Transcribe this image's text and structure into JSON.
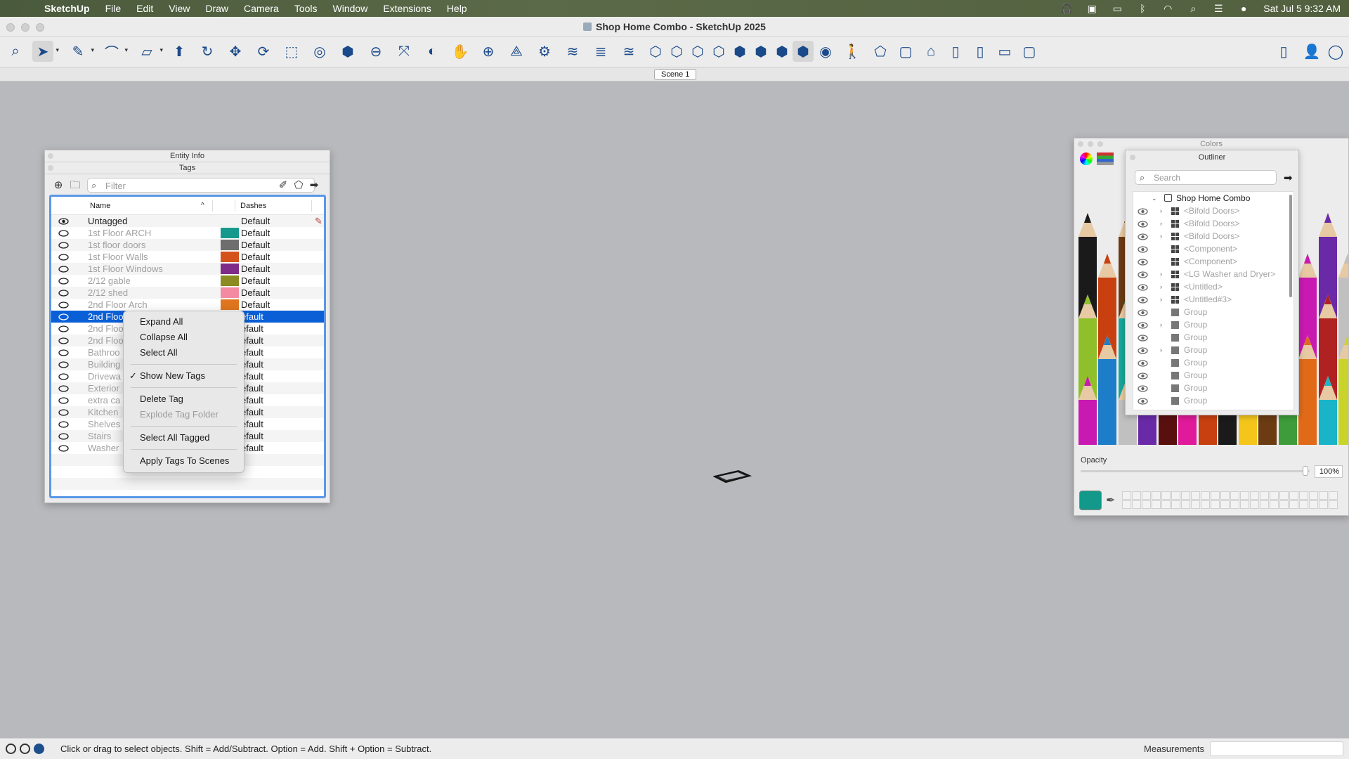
{
  "menubar": {
    "app_name": "SketchUp",
    "items": [
      "File",
      "Edit",
      "View",
      "Draw",
      "Camera",
      "Tools",
      "Window",
      "Extensions",
      "Help"
    ],
    "clock": "Sat Jul 5  9:32 AM"
  },
  "window": {
    "title": "Shop Home Combo - SketchUp 2025"
  },
  "scenes": {
    "tabs": [
      "Scene 1"
    ]
  },
  "entity_info": {
    "title": "Entity Info"
  },
  "tags_panel": {
    "title": "Tags",
    "filter_placeholder": "Filter",
    "col_name": "Name",
    "col_dashes": "Dashes",
    "rows": [
      {
        "name": "Untagged",
        "color": "",
        "dashes": "Default",
        "active": true
      },
      {
        "name": "1st Floor ARCH",
        "color": "#16998c",
        "dashes": "Default"
      },
      {
        "name": "1st floor doors",
        "color": "#6e6e6e",
        "dashes": "Default"
      },
      {
        "name": "1st Floor Walls",
        "color": "#d4531d",
        "dashes": "Default"
      },
      {
        "name": "1st Floor Windows",
        "color": "#7e2b89",
        "dashes": "Default"
      },
      {
        "name": "2/12 gable",
        "color": "#8b8b21",
        "dashes": "Default"
      },
      {
        "name": "2/12 shed",
        "color": "#f38aa2",
        "dashes": "Default"
      },
      {
        "name": "2nd Floor Arch",
        "color": "#e0771f",
        "dashes": "Default"
      },
      {
        "name": "2nd Floo",
        "color": "",
        "dashes": "efault",
        "selected": true
      },
      {
        "name": "2nd Floo",
        "color": "",
        "dashes": "efault"
      },
      {
        "name": "2nd Floo",
        "color": "",
        "dashes": "efault"
      },
      {
        "name": "Bathroo",
        "color": "",
        "dashes": "efault"
      },
      {
        "name": "Building",
        "color": "",
        "dashes": "efault"
      },
      {
        "name": "Drivewa",
        "color": "",
        "dashes": "efault"
      },
      {
        "name": "Exterior",
        "color": "",
        "dashes": "efault"
      },
      {
        "name": "extra ca",
        "color": "",
        "dashes": "efault"
      },
      {
        "name": "Kitchen",
        "color": "",
        "dashes": "efault"
      },
      {
        "name": "Shelves",
        "color": "",
        "dashes": "efault"
      },
      {
        "name": "Stairs",
        "color": "",
        "dashes": "efault"
      },
      {
        "name": "Washer",
        "color": "",
        "dashes": "efault"
      }
    ]
  },
  "context_menu": {
    "items": [
      {
        "label": "Expand All"
      },
      {
        "label": "Collapse All"
      },
      {
        "label": "Select All"
      },
      {
        "sep": true
      },
      {
        "label": "Show New Tags",
        "checked": true
      },
      {
        "sep": true
      },
      {
        "label": "Delete Tag"
      },
      {
        "label": "Explode Tag Folder",
        "disabled": true
      },
      {
        "sep": true
      },
      {
        "label": "Select All Tagged"
      },
      {
        "sep": true
      },
      {
        "label": "Apply Tags To Scenes"
      }
    ]
  },
  "colors_panel": {
    "title": "Colors",
    "opacity_label": "Opacity",
    "opacity_value": "100%",
    "opacity_fraction": 1.0,
    "current_color": "#12998a"
  },
  "outliner": {
    "title": "Outliner",
    "search_placeholder": "Search",
    "root": "Shop Home Combo",
    "items": [
      {
        "label": "<Bifold Doors>",
        "type": "component",
        "expandable": true
      },
      {
        "label": "<Bifold Doors>",
        "type": "component",
        "expandable": true
      },
      {
        "label": "<Bifold Doors>",
        "type": "component",
        "expandable": true
      },
      {
        "label": "<Component>",
        "type": "component",
        "expandable": false
      },
      {
        "label": "<Component>",
        "type": "component",
        "expandable": false
      },
      {
        "label": "<LG Washer and Dryer>",
        "type": "component",
        "expandable": true
      },
      {
        "label": "<Untitled>",
        "type": "component",
        "expandable": true
      },
      {
        "label": "<Untitled#3>",
        "type": "component",
        "expandable": true
      },
      {
        "label": "Group",
        "type": "group",
        "expandable": false
      },
      {
        "label": "Group",
        "type": "group",
        "expandable": true
      },
      {
        "label": "Group",
        "type": "group",
        "expandable": false
      },
      {
        "label": "Group",
        "type": "group",
        "expandable": true
      },
      {
        "label": "Group",
        "type": "group",
        "expandable": false
      },
      {
        "label": "Group",
        "type": "group",
        "expandable": false
      },
      {
        "label": "Group",
        "type": "group",
        "expandable": false
      },
      {
        "label": "Group",
        "type": "group",
        "expandable": false
      }
    ]
  },
  "statusbar": {
    "hint": "Click or drag to select objects. Shift = Add/Subtract. Option = Add. Shift + Option = Subtract.",
    "measurements_label": "Measurements"
  }
}
